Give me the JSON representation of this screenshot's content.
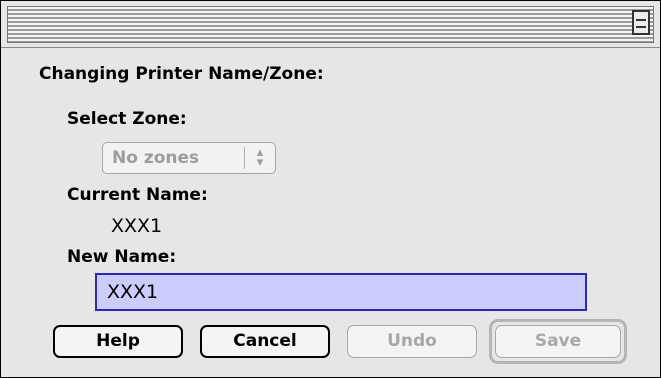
{
  "dialog": {
    "heading": "Changing Printer Name/Zone:",
    "select_zone_label": "Select Zone:",
    "zone_popup_value": "No zones",
    "current_name_label": "Current Name:",
    "current_name_value": "XXX1",
    "new_name_label": "New Name:",
    "new_name_value": "XXX1"
  },
  "buttons": {
    "help": "Help",
    "cancel": "Cancel",
    "undo": "Undo",
    "save": "Save"
  },
  "icons": {
    "collapse": "window-collapse-icon",
    "popup_arrows": "up-down-arrows-icon"
  },
  "colors": {
    "field_bg": "#ccccff",
    "field_border": "#2b2bb0",
    "disabled_text": "#a8a8a8"
  }
}
